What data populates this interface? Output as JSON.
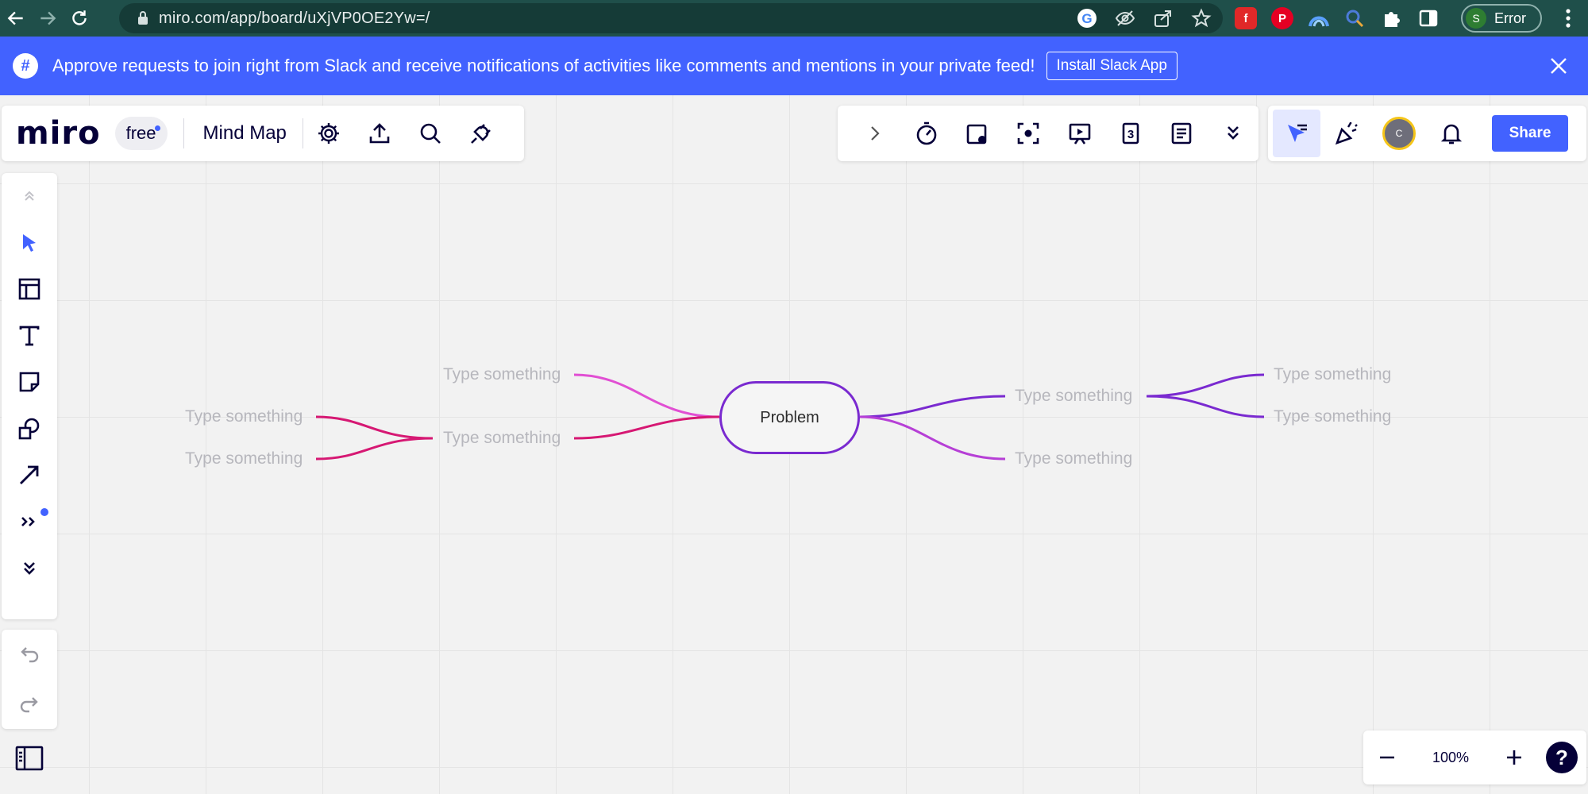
{
  "browser": {
    "url": "miro.com/app/board/uXjVP0OE2Yw=/",
    "profile_initial": "S",
    "profile_label": "Error",
    "extensions": [
      {
        "name": "flipboard-icon",
        "color": "#e12828",
        "glyph": "f"
      },
      {
        "name": "pinterest-icon",
        "color": "#e60023",
        "glyph": "P"
      }
    ]
  },
  "banner": {
    "text": "Approve requests to join right from Slack and receive notifications of activities like comments and mentions in your private feed!",
    "button_label": "Install Slack App"
  },
  "header": {
    "logo": "miro",
    "plan": "free",
    "board_title": "Mind Map"
  },
  "collaborator": {
    "initial": "C"
  },
  "share_label": "Share",
  "zoom": {
    "level": "100%"
  },
  "help_label": "?",
  "mindmap": {
    "root": "Problem",
    "nodes": [
      {
        "label": "Type something",
        "side": "left",
        "level": 1
      },
      {
        "label": "Type something",
        "side": "left",
        "level": 1
      },
      {
        "label": "Type something",
        "side": "left",
        "level": 2
      },
      {
        "label": "Type something",
        "side": "left",
        "level": 2
      },
      {
        "label": "Type something",
        "side": "right",
        "level": 1
      },
      {
        "label": "Type something",
        "side": "right",
        "level": 1
      },
      {
        "label": "Type something",
        "side": "right",
        "level": 2
      },
      {
        "label": "Type something",
        "side": "right",
        "level": 2
      }
    ],
    "colors": {
      "left_top": "#e14fd3",
      "left_bottom": "#d61873",
      "right_top": "#7a2ad0",
      "right_bottom": "#b63fd6",
      "root_border": "#7a2ad0"
    }
  }
}
